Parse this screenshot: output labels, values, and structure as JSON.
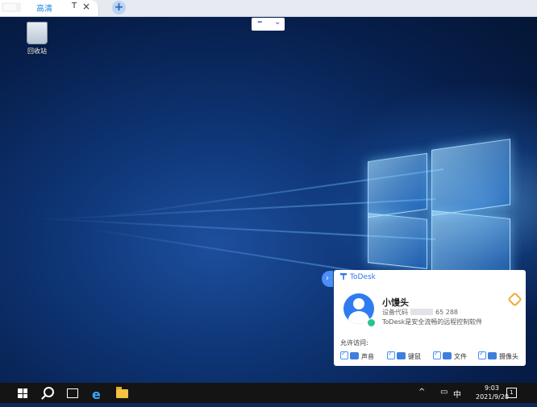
{
  "browser": {
    "tab_label": "高清",
    "tab_extra": "T",
    "tab_close": "×",
    "new_tab": "+"
  },
  "remote_toolbar": {
    "minimize": "–",
    "expand": "⌄"
  },
  "desktop": {
    "recycle_bin_label": "回收站"
  },
  "todesk": {
    "brand": "ToDesk",
    "toggle_glyph": "›",
    "user_name": "小馒头",
    "device_code_label": "设备代码",
    "device_code_visible": "65  288",
    "tagline": "ToDesk是安全流畅的远程控制软件",
    "permissions_title": "允许访问:",
    "permissions": [
      "声音",
      "键鼠",
      "文件",
      "摄像头"
    ],
    "accent_color": "#2f76e8"
  },
  "taskbar": {
    "clock_time": "9:03",
    "clock_date": "2021/9/20",
    "ime": "中",
    "chevron": "^",
    "notif_count": "1"
  }
}
